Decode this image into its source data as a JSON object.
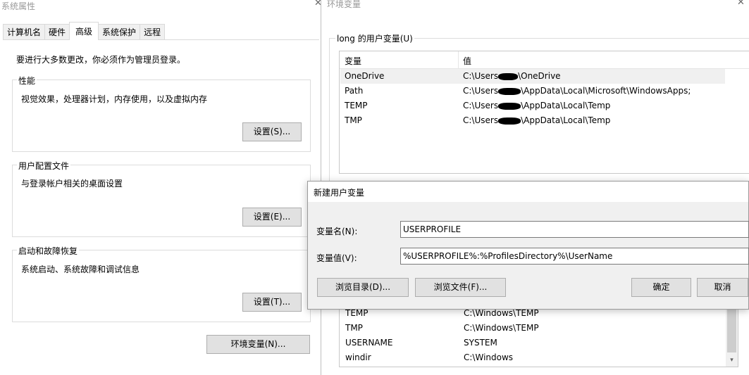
{
  "system_properties": {
    "title": "系统属性",
    "close_glyph": "✕",
    "tabs": [
      "计算机名",
      "硬件",
      "高级",
      "系统保护",
      "远程"
    ],
    "active_tab": "高级",
    "admin_note": "要进行大多数更改，你必须作为管理员登录。",
    "performance": {
      "title": "性能",
      "description": "视觉效果，处理器计划，内存使用，以及虚拟内存",
      "button": "设置(S)..."
    },
    "user_profiles": {
      "title": "用户配置文件",
      "description": "与登录帐户相关的桌面设置",
      "button": "设置(E)..."
    },
    "startup_recovery": {
      "title": "启动和故障恢复",
      "description": "系统启动、系统故障和调试信息",
      "button": "设置(T)..."
    },
    "env_button": "环境变量(N)..."
  },
  "env_vars": {
    "title": "环境变量",
    "close_glyph": "✕",
    "user_group_title": "long 的用户变量(U)",
    "columns": {
      "name": "变量",
      "value": "值"
    },
    "user_vars": [
      {
        "name": "OneDrive",
        "prefix": "C:\\Users",
        "suffix": "\\OneDrive"
      },
      {
        "name": "Path",
        "prefix": "C:\\Users",
        "suffix": "\\AppData\\Local\\Microsoft\\WindowsApps;"
      },
      {
        "name": "TEMP",
        "prefix": "C:\\Users",
        "suffix": "\\AppData\\Local\\Temp"
      },
      {
        "name": "TMP",
        "prefix": "C:\\Users",
        "suffix": "\\AppData\\Local\\Temp"
      }
    ],
    "system_vars": [
      {
        "name": "TEMP",
        "value": "C:\\Windows\\TEMP"
      },
      {
        "name": "TMP",
        "value": "C:\\Windows\\TEMP"
      },
      {
        "name": "USERNAME",
        "value": "SYSTEM"
      },
      {
        "name": "windir",
        "value": "C:\\Windows"
      }
    ],
    "scroll_down_glyph": "▾"
  },
  "new_var_dialog": {
    "title": "新建用户变量",
    "name_label": "变量名(N):",
    "name_value": "USERPROFILE",
    "value_label": "变量值(V):",
    "value_value": "%USERPROFILE%:%ProfilesDirectory%\\UserName",
    "browse_dir": "浏览目录(D)...",
    "browse_file": "浏览文件(F)...",
    "ok": "确定",
    "cancel": "取消"
  }
}
